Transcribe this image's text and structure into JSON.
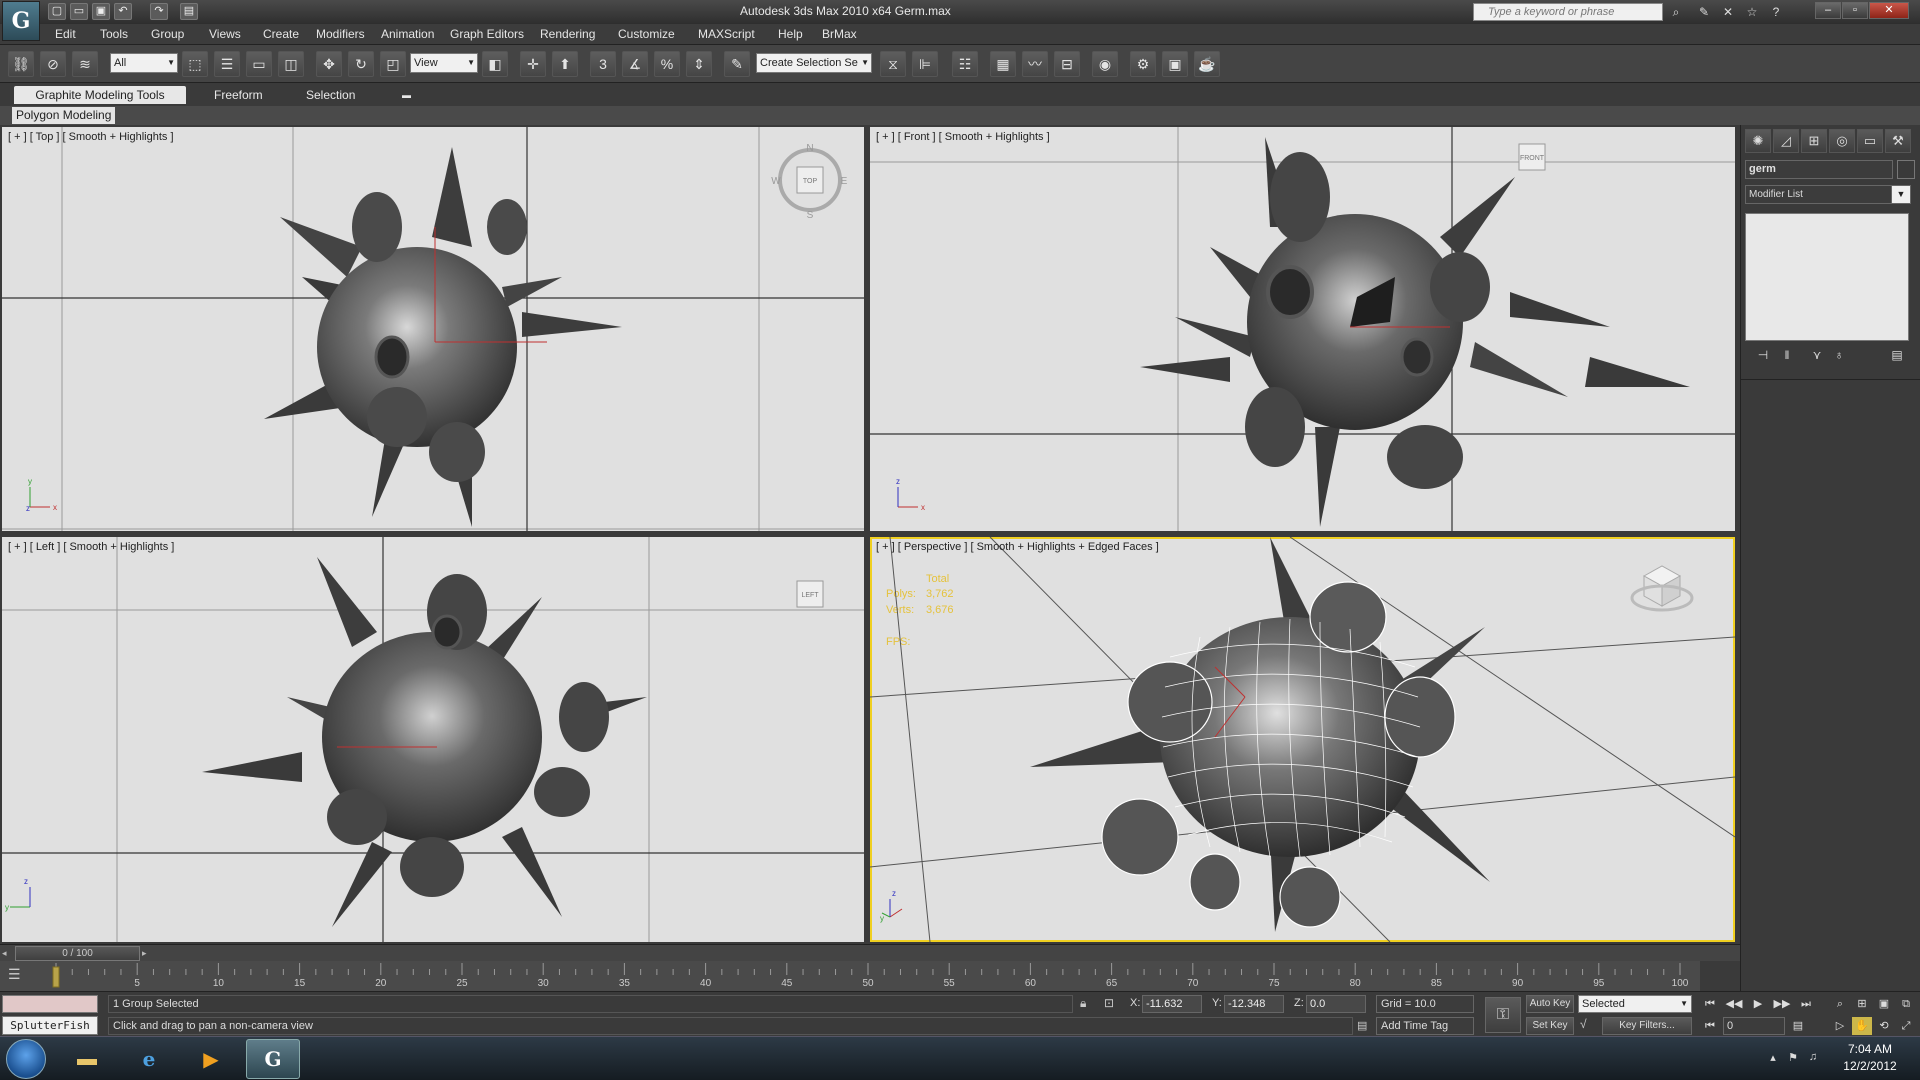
{
  "window": {
    "title": "Autodesk 3ds Max  2010 x64      Germ.max",
    "search_placeholder": "Type a keyword or phrase",
    "logo_letter": "G"
  },
  "menu": [
    "Edit",
    "Tools",
    "Group",
    "Views",
    "Create",
    "Modifiers",
    "Animation",
    "Graph Editors",
    "Rendering",
    "Customize",
    "MAXScript",
    "Help",
    "BrMax"
  ],
  "toolbar": {
    "selection_filter": "All",
    "ref_coord": "View",
    "named_selection": "Create Selection Se",
    "snap_labels": [
      "3",
      "%"
    ]
  },
  "ribbon": {
    "tabs": [
      "Graphite Modeling Tools",
      "Freeform",
      "Selection"
    ],
    "panel": "Polygon Modeling"
  },
  "viewports": {
    "top": {
      "label": "[ + ] [ Top ] [ Smooth + Highlights ]",
      "cube": "TOP",
      "compass": [
        "N",
        "E",
        "S",
        "W"
      ]
    },
    "front": {
      "label": "[ + ] [ Front ] [ Smooth + Highlights ]",
      "cube": "FRONT"
    },
    "left": {
      "label": "[ + ] [ Left ] [ Smooth + Highlights ]",
      "cube": "LEFT"
    },
    "perspective": {
      "label": "[ + ] [ Perspective ] [ Smooth + Highlights + Edged Faces ]",
      "stats_title": "Total",
      "polys_label": "Polys:",
      "polys_value": "3,762",
      "verts_label": "Verts:",
      "verts_value": "3,676",
      "fps_label": "FPS:"
    }
  },
  "command_panel": {
    "object_name": "germ",
    "modifier_list": "Modifier List"
  },
  "timeline": {
    "slider_text": "0 / 100",
    "ticks": [
      "5",
      "10",
      "15",
      "20",
      "25",
      "30",
      "35",
      "40",
      "45",
      "50",
      "55",
      "60",
      "65",
      "70",
      "75",
      "80",
      "85",
      "90",
      "95",
      "100"
    ]
  },
  "status": {
    "listener_label": "SplutterFish",
    "selection": "1 Group Selected",
    "prompt": "Click and drag to pan a non-camera view",
    "x_label": "X:",
    "x_value": "-11.632",
    "y_label": "Y:",
    "y_value": "-12.348",
    "z_label": "Z:",
    "z_value": "0.0",
    "grid": "Grid = 10.0",
    "add_time_tag": "Add Time Tag",
    "auto_key": "Auto Key",
    "set_key": "Set Key",
    "key_mode": "Selected",
    "key_filters": "Key Filters...",
    "frame": "0"
  },
  "taskbar": {
    "time": "7:04 AM",
    "date": "12/2/2012"
  },
  "colors": {
    "viewport_bg": "#e0e0e0",
    "active_border": "#f0d020",
    "stats_text": "#e5c23c"
  }
}
